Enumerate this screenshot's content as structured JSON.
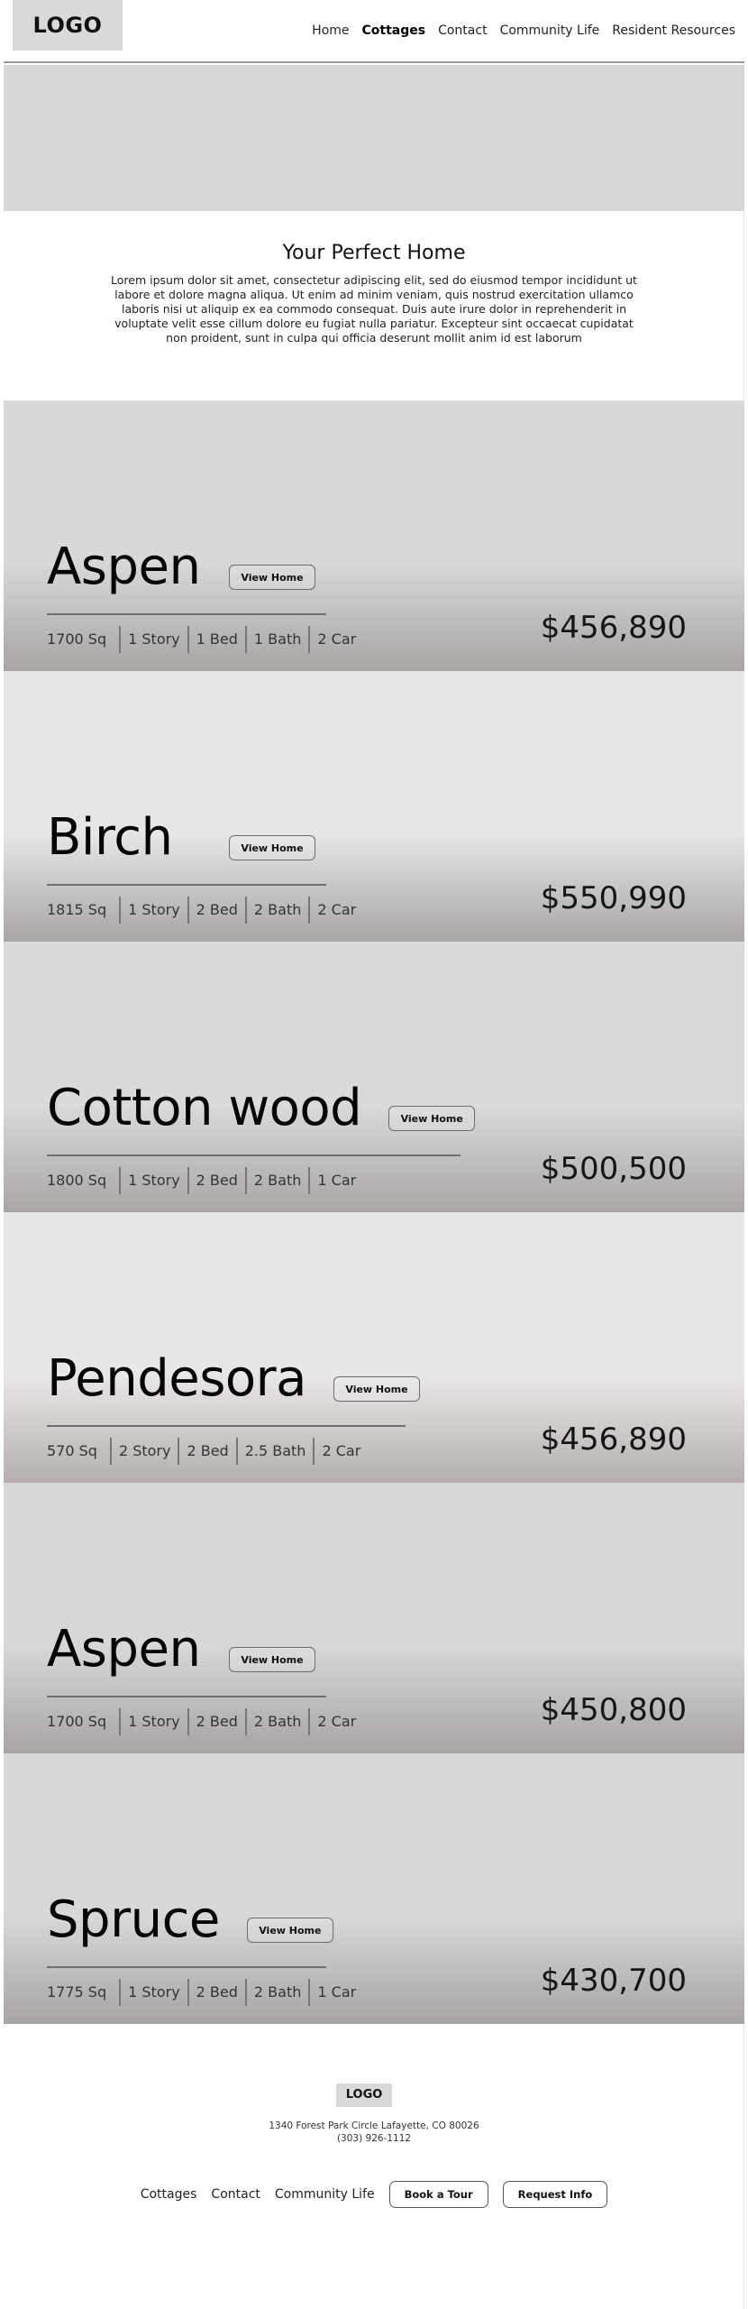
{
  "header": {
    "logo": "LOGO",
    "nav": [
      {
        "label": "Home"
      },
      {
        "label": "Cottages",
        "active": true
      },
      {
        "label": "Contact"
      },
      {
        "label": "Community Life"
      },
      {
        "label": "Resident Resources"
      }
    ]
  },
  "intro": {
    "title": "Your Perfect Home",
    "body": "Lorem ipsum dolor sit amet, consectetur adipiscing elit, sed do eiusmod tempor incididunt ut labore et dolore magna aliqua. Ut enim ad minim veniam, quis nostrud exercitation ullamco laboris nisi ut aliquip ex ea commodo consequat. Duis aute irure dolor in reprehenderit in voluptate velit esse cillum dolore eu fugiat nulla pariatur. Excepteur sint occaecat cupidatat non proident, sunt in culpa qui officia deserunt mollit anim id est laborum"
  },
  "homes": [
    {
      "name": "Aspen",
      "button": "View Home",
      "specs": [
        "1700 Sq",
        "1 Story",
        "1 Bed",
        "1 Bath",
        "2 Car"
      ],
      "price": "$456,890",
      "bg": "#d8d8d8",
      "shade": "#a8a5a3"
    },
    {
      "name": "Birch",
      "button": "View Home",
      "specs": [
        "1815 Sq",
        "1 Story",
        "2 Bed",
        "2 Bath",
        "2 Car"
      ],
      "price": "$550,990",
      "bg": "#e6e6e6",
      "shade": "#a9a6a4"
    },
    {
      "name": "Cotton wood",
      "button": "View Home",
      "specs": [
        "1800 Sq",
        "1 Story",
        "2 Bed",
        "2 Bath",
        "1 Car"
      ],
      "price": "$500,500",
      "bg": "#dadada",
      "shade": "#a9a6a4"
    },
    {
      "name": "Pendesora",
      "button": "View Home",
      "specs": [
        "570 Sq",
        "2 Story",
        "2 Bed",
        "2.5 Bath",
        "2 Car"
      ],
      "price": "$456,890",
      "bg": "#e9e7e6",
      "shade": "#b5afad"
    },
    {
      "name": "Aspen",
      "button": "View Home",
      "specs": [
        "1700 Sq",
        "1 Story",
        "2 Bed",
        "2 Bath",
        "2 Car"
      ],
      "price": "$450,800",
      "bg": "#d8d8d8",
      "shade": "#a8a5a3"
    },
    {
      "name": "Spruce",
      "button": "View Home",
      "specs": [
        "1775 Sq",
        "1 Story",
        "2 Bed",
        "2 Bath",
        "1 Car"
      ],
      "price": "$430,700",
      "bg": "#d8d8d8",
      "shade": "#a8a5a3"
    }
  ],
  "footer": {
    "logo": "LOGO",
    "address": "1340 Forest Park Circle Lafayette, CO 80026",
    "phone": "(303) 926-1112",
    "links": [
      "Cottages",
      "Contact",
      "Community Life"
    ],
    "buttons": [
      "Book a Tour",
      "Request Info"
    ]
  }
}
